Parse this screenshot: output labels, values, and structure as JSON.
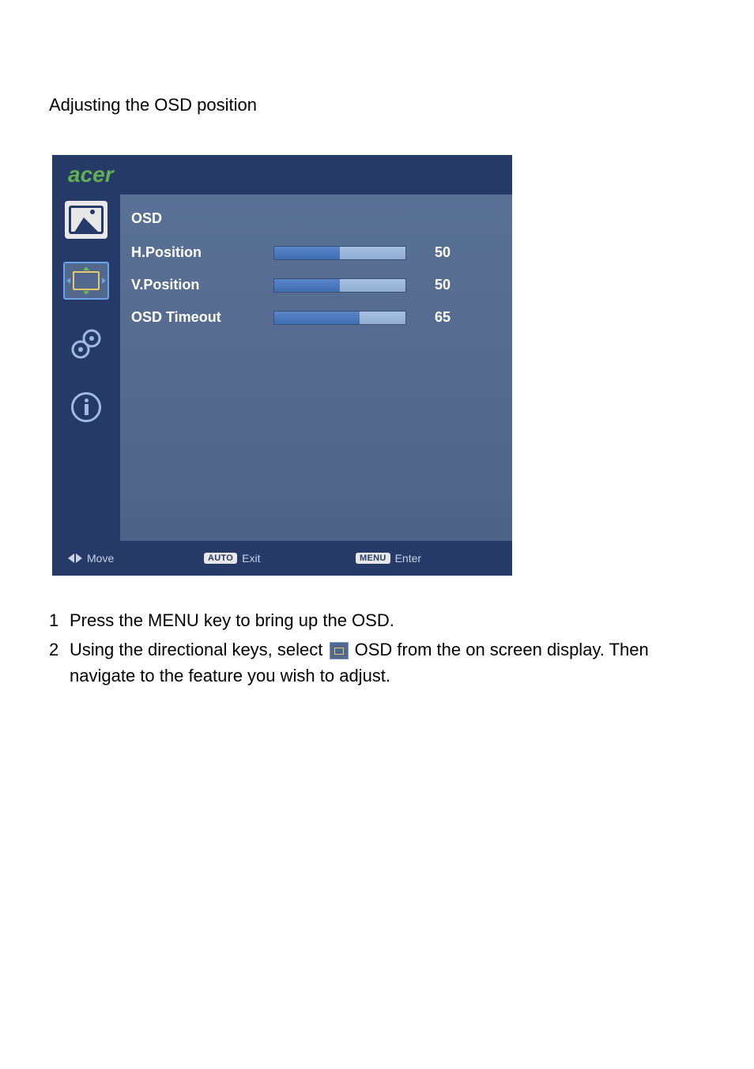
{
  "heading": "Adjusting the OSD position",
  "brand": "acer",
  "osd": {
    "section_title": "OSD",
    "rows": [
      {
        "label": "H.Position",
        "value": "50",
        "pct": 50
      },
      {
        "label": "V.Position",
        "value": "50",
        "pct": 50
      },
      {
        "label": "OSD Timeout",
        "value": "65",
        "pct": 65
      }
    ]
  },
  "footer": {
    "move": "Move",
    "auto_badge": "AUTO",
    "exit": "Exit",
    "menu_badge": "MENU",
    "enter": "Enter"
  },
  "instructions": {
    "items": [
      {
        "num": "1",
        "text": "Press the MENU key to bring up the OSD."
      },
      {
        "num": "2",
        "before": "Using the directional keys, select ",
        "after": " OSD from the on screen display. Then navigate to the feature you wish to adjust."
      }
    ]
  }
}
